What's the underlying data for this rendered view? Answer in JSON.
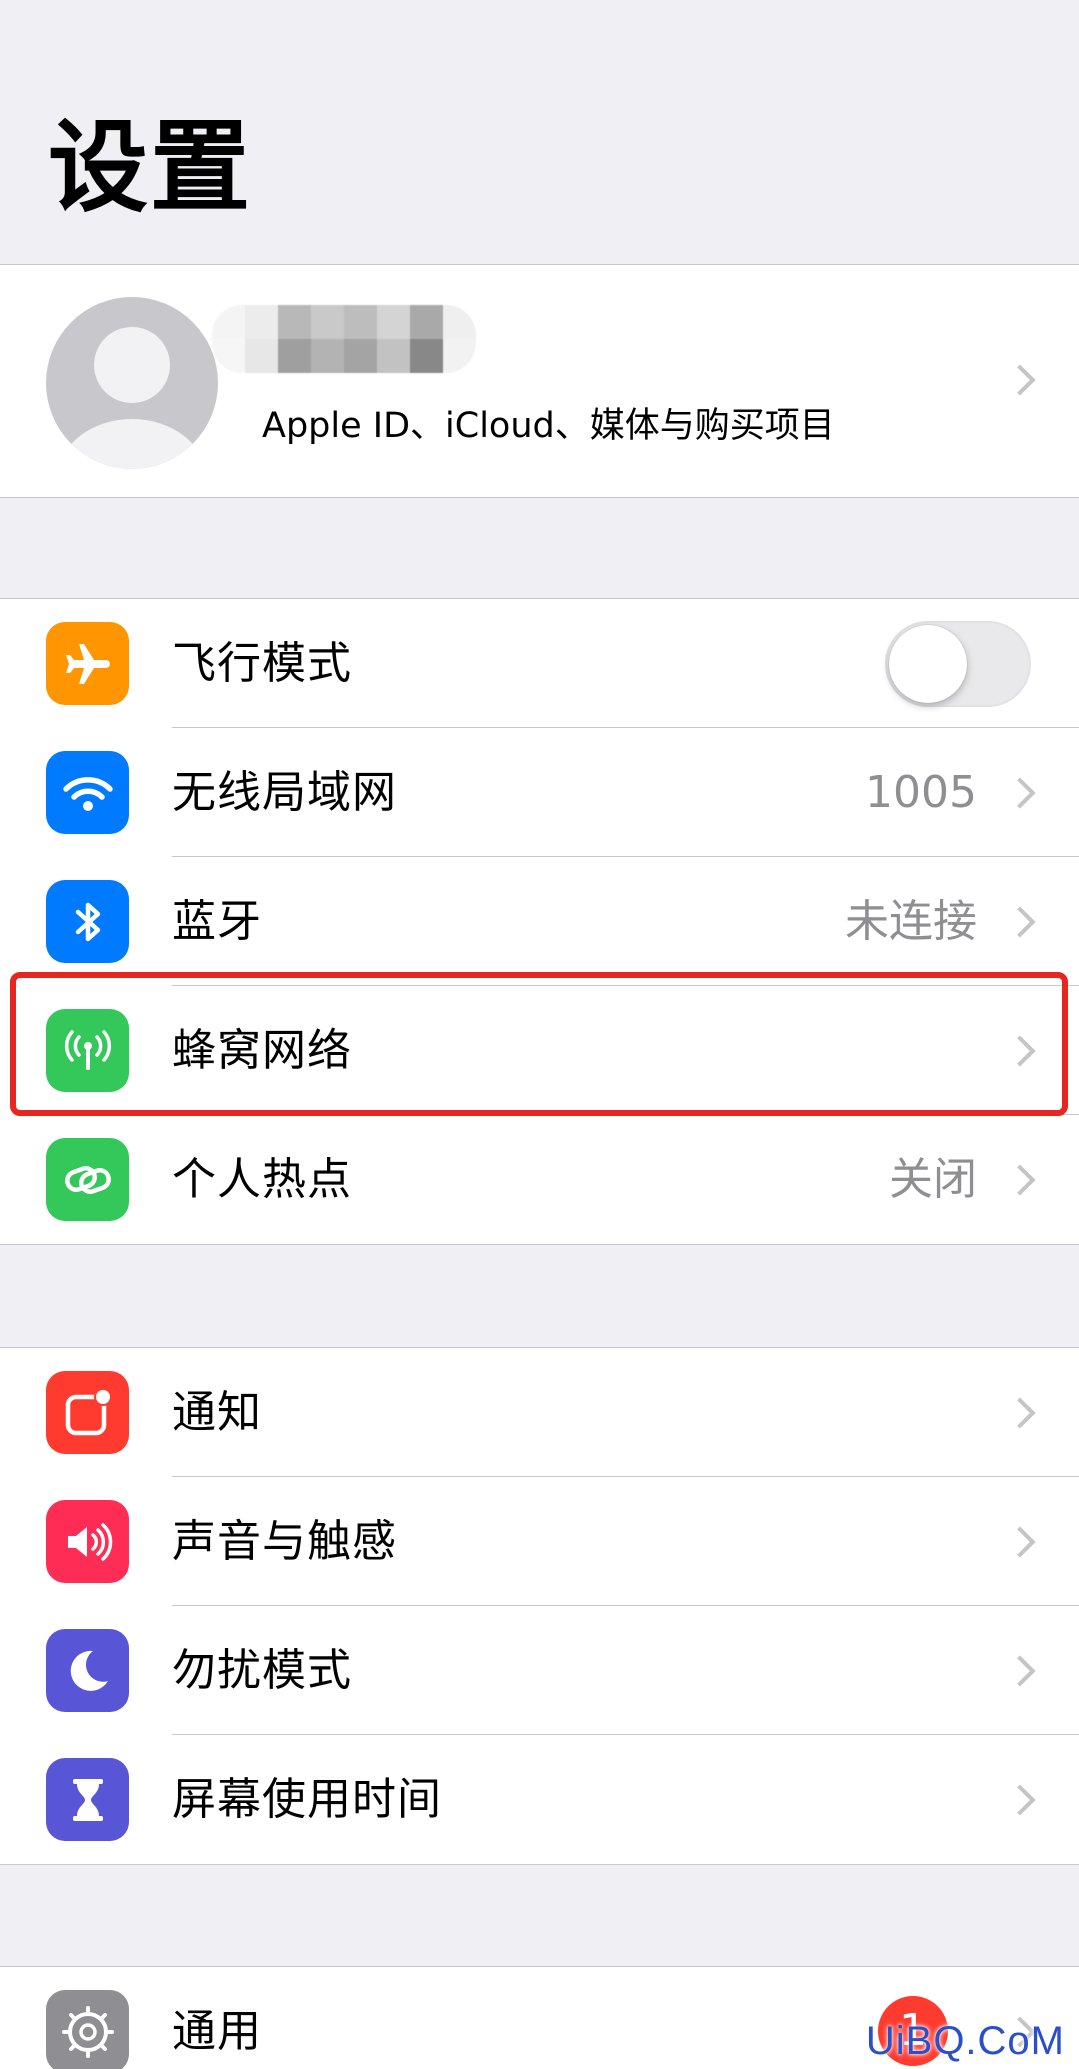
{
  "page": {
    "title": "设置"
  },
  "profile": {
    "subtitle": "Apple ID、iCloud、媒体与购买项目"
  },
  "network_group": [
    {
      "id": "airplane",
      "label": "飞行模式",
      "value": "",
      "toggle_on": false,
      "icon": "airplane-icon",
      "icon_color": "#ff9500"
    },
    {
      "id": "wifi",
      "label": "无线局域网",
      "value": "1005",
      "icon": "wifi-icon",
      "icon_color": "#007aff"
    },
    {
      "id": "bluetooth",
      "label": "蓝牙",
      "value": "未连接",
      "icon": "bluetooth-icon",
      "icon_color": "#007aff"
    },
    {
      "id": "cellular",
      "label": "蜂窝网络",
      "value": "",
      "icon": "antenna-icon",
      "icon_color": "#34c759"
    },
    {
      "id": "hotspot",
      "label": "个人热点",
      "value": "关闭",
      "icon": "chain-link-icon",
      "icon_color": "#34c759"
    }
  ],
  "notify_group": [
    {
      "id": "notifications",
      "label": "通知",
      "icon": "notification-icon",
      "icon_color": "#ff3b30"
    },
    {
      "id": "sounds",
      "label": "声音与触感",
      "icon": "speaker-icon",
      "icon_color": "#ff2d55"
    },
    {
      "id": "dnd",
      "label": "勿扰模式",
      "icon": "moon-icon",
      "icon_color": "#5856d6"
    },
    {
      "id": "screentime",
      "label": "屏幕使用时间",
      "icon": "hourglass-icon",
      "icon_color": "#5856d6"
    }
  ],
  "general_group": [
    {
      "id": "general",
      "label": "通用",
      "icon": "gear-icon",
      "icon_color": "#8e8e93",
      "badge": "1"
    }
  ],
  "watermark": "UiBQ.CoM",
  "colors": {
    "background": "#efeff4",
    "highlight": "#e8261f",
    "separator": "#c8c7cc",
    "secondary_text": "#8e8e93"
  }
}
